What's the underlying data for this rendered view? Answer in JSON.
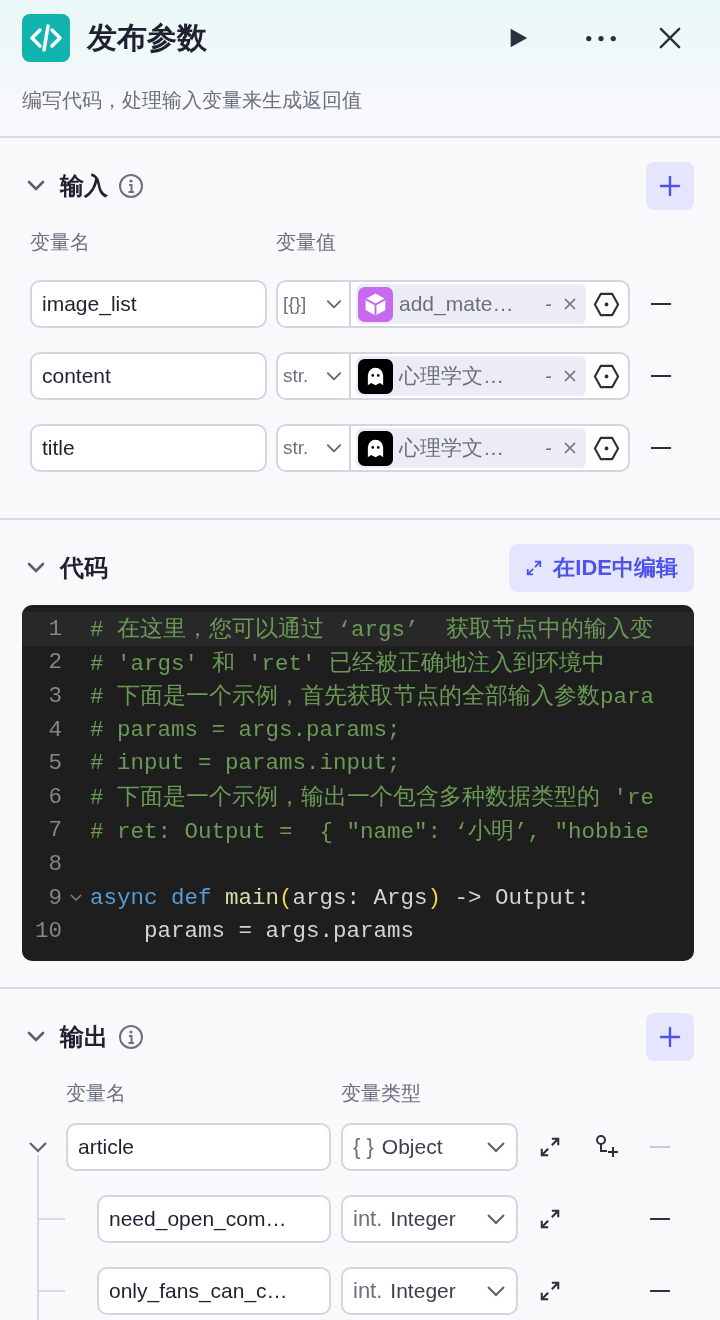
{
  "header": {
    "title": "发布参数",
    "description": "编写代码，处理输入变量来生成返回值"
  },
  "input": {
    "title": "输入",
    "expanded": true,
    "columns": [
      "变量名",
      "变量值"
    ],
    "rows": [
      {
        "name": "image_list",
        "type": "[{}]",
        "kind": "cube",
        "reference": "add_mate…",
        "separator": "-"
      },
      {
        "name": "content",
        "type": "str.",
        "kind": "ghost",
        "reference": "心理学文…",
        "separator": "-"
      },
      {
        "name": "title",
        "type": "str.",
        "kind": "ghost",
        "reference": "心理学文…",
        "separator": "-"
      }
    ]
  },
  "code": {
    "title": "代码",
    "expanded": true,
    "ide_button": "在IDE中编辑",
    "lines": [
      {
        "number": "1",
        "current": true,
        "foldable": false,
        "tokens": [
          {
            "kind": "comment",
            "text": "# 在这里，您可以通过 ‘args’  获取节点中的输入变"
          }
        ]
      },
      {
        "number": "2",
        "current": false,
        "foldable": false,
        "tokens": [
          {
            "kind": "comment",
            "text": "# 'args' 和 'ret' 已经被正确地注入到环境中"
          }
        ]
      },
      {
        "number": "3",
        "current": false,
        "foldable": false,
        "tokens": [
          {
            "kind": "comment",
            "text": "# 下面是一个示例，首先获取节点的全部输入参数para"
          }
        ]
      },
      {
        "number": "4",
        "current": false,
        "foldable": false,
        "tokens": [
          {
            "kind": "comment",
            "text": "# params = args.params;"
          }
        ]
      },
      {
        "number": "5",
        "current": false,
        "foldable": false,
        "tokens": [
          {
            "kind": "comment",
            "text": "# input = params.input;"
          }
        ]
      },
      {
        "number": "6",
        "current": false,
        "foldable": false,
        "tokens": [
          {
            "kind": "comment",
            "text": "# 下面是一个示例，输出一个包含多种数据类型的 're"
          }
        ]
      },
      {
        "number": "7",
        "current": false,
        "foldable": false,
        "tokens": [
          {
            "kind": "comment",
            "text": "# ret: Output =  { \"name\": ‘小明’, \"hobbie"
          }
        ]
      },
      {
        "number": "8",
        "current": false,
        "foldable": false
      },
      {
        "number": "9",
        "current": false,
        "foldable": true,
        "tokens": [
          {
            "kind": "keyword",
            "text": "async def "
          },
          {
            "kind": "function",
            "text": "main"
          },
          {
            "kind": "paren",
            "text": "("
          },
          {
            "kind": "plain",
            "text": "args: Args"
          },
          {
            "kind": "paren",
            "text": ")"
          },
          {
            "kind": "plain",
            "text": " -> Output:"
          }
        ]
      },
      {
        "number": "10",
        "current": false,
        "foldable": false,
        "tokens": [
          {
            "kind": "plain",
            "text": "    params = args.params"
          }
        ]
      }
    ]
  },
  "output": {
    "title": "输出",
    "expanded": true,
    "columns": [
      "变量名",
      "变量类型"
    ],
    "rows": [
      {
        "name": "article",
        "type_icon": "{ }",
        "type": "Object",
        "expanded": true,
        "can_add_child": true,
        "removable": false,
        "children": [
          {
            "name": "need_open_com…",
            "type_icon": "int.",
            "type": "Integer",
            "removable": true
          },
          {
            "name": "only_fans_can_c…",
            "type_icon": "int.",
            "type": "Integer",
            "removable": true
          }
        ]
      }
    ]
  }
}
